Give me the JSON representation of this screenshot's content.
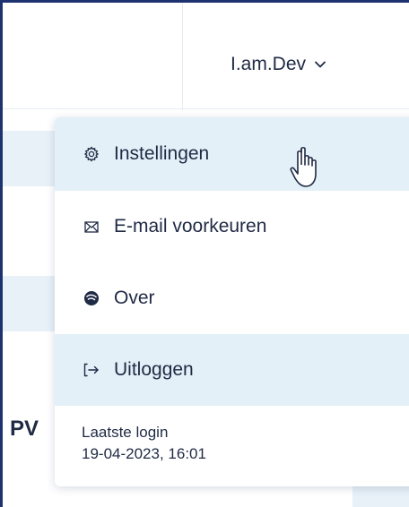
{
  "header": {
    "username": "I.am.Dev"
  },
  "background": {
    "partial_text": "PV"
  },
  "menu": {
    "items": [
      {
        "label": "Instellingen",
        "icon": "gear-icon"
      },
      {
        "label": "E-mail voorkeuren",
        "icon": "envelope-icon"
      },
      {
        "label": "Over",
        "icon": "info-circle-icon"
      },
      {
        "label": "Uitloggen",
        "icon": "logout-icon"
      }
    ],
    "last_login": {
      "label": "Laatste login",
      "value": "19-04-2023, 16:01"
    }
  },
  "colors": {
    "text": "#1f2a44",
    "highlight": "#e4f0f8",
    "frame_border": "#1e3270"
  }
}
